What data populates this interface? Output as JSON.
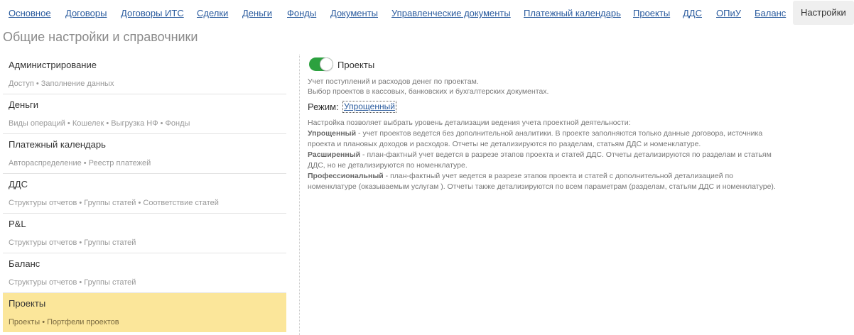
{
  "topnav": {
    "tabs": [
      {
        "label": "Основное"
      },
      {
        "label": "Договоры"
      },
      {
        "label": "Договоры ИТС"
      },
      {
        "label": "Сделки"
      },
      {
        "label": "Деньги"
      },
      {
        "label": "Фонды"
      },
      {
        "label": "Документы"
      },
      {
        "label": "Управленческие документы"
      },
      {
        "label": "Платежный календарь"
      },
      {
        "label": "Проекты"
      },
      {
        "label": "ДДС"
      },
      {
        "label": "ОПиУ"
      },
      {
        "label": "Баланс"
      },
      {
        "label": "Настройки",
        "active": true
      }
    ]
  },
  "page": {
    "title": "Общие настройки и справочники"
  },
  "sections": [
    {
      "name": "Администрирование",
      "sub": "Доступ • Заполнение данных"
    },
    {
      "name": "Деньги",
      "sub": "Виды операций • Кошелек • Выгрузка НФ • Фонды"
    },
    {
      "name": "Платежный календарь",
      "sub": "Автораспределение • Реестр платежей"
    },
    {
      "name": "ДДС",
      "sub": "Структуры отчетов • Группы статей • Соответствие статей"
    },
    {
      "name": "P&L",
      "sub": "Структуры отчетов • Группы статей"
    },
    {
      "name": "Баланс",
      "sub": "Структуры отчетов • Группы статей"
    },
    {
      "name": "Проекты",
      "sub": "Проекты • Портфели проектов",
      "selected": true
    }
  ],
  "details": {
    "toggle_label": "Проекты",
    "toggle_on": true,
    "desc_line1": "Учет поступлений и расходов денег по проектам.",
    "desc_line2": "Выбор проектов в кассовых, банковских и бухгалтерских документах.",
    "mode_label": "Режим:",
    "mode_value": "Упрощенный",
    "help_intro": "Настройка позволяет выбрать уровень детализации ведения учета проектной деятельности:",
    "simple_term": "Упрощенный",
    "simple_line1": " - учет проектов ведется без дополнительной аналитики. В проекте заполняются только данные договора, источника",
    "simple_line2": "проекта и плановых доходов и расходов. Отчеты не детализируются по разделам, статьям ДДС и номенклатуре.",
    "extended_term": "Расширенный",
    "extended_line1": " - план-фактный учет ведется в разрезе этапов проекта и статей ДДС. Отчеты детализируются по разделам и статьям",
    "extended_line2": "ДДС, но не детализируются по номенклатуре.",
    "pro_term": "Профессиональный",
    "pro_line1": " - план-фактный учет ведется в разрезе этапов проекта и статей с дополнительной детализацией по",
    "pro_line2": "номенклатуре (оказываемым услугам ). Отчеты также детализируются по всем параметрам (разделам, статьям ДДС и номенклатуре)."
  },
  "colors": {
    "link": "#2a5b9e",
    "toggle_on": "#2ca13f",
    "selected_row": "#fbe69a",
    "active_tab_bg": "#efefef"
  }
}
